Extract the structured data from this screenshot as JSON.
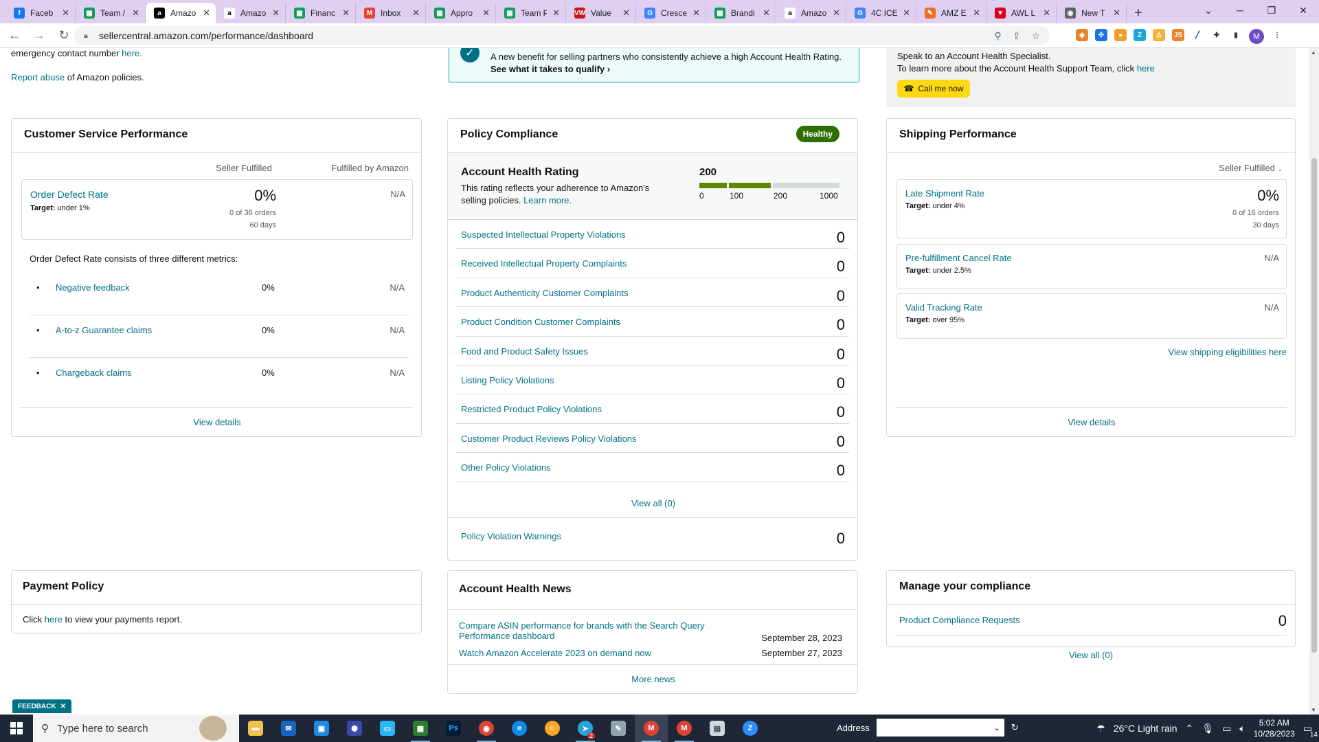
{
  "browser": {
    "tabs": [
      {
        "title": "Faceb",
        "icon": "facebook-icon",
        "color": "#1877f2",
        "glyph": "f"
      },
      {
        "title": "Team /",
        "icon": "sheets-icon",
        "color": "#0f9d58",
        "glyph": "▦"
      },
      {
        "title": "Amazo",
        "icon": "amazon-icon",
        "color": "#000000",
        "glyph": "a",
        "active": true
      },
      {
        "title": "Amazo",
        "icon": "amazon-icon",
        "color": "#ffffff",
        "glyph": "a"
      },
      {
        "title": "Financ",
        "icon": "sheets-icon",
        "color": "#0f9d58",
        "glyph": "▦"
      },
      {
        "title": "Inbox",
        "icon": "gmail-icon",
        "color": "#ea4335",
        "glyph": "M"
      },
      {
        "title": "Appro",
        "icon": "sheets-icon",
        "color": "#0f9d58",
        "glyph": "▦"
      },
      {
        "title": "Team P",
        "icon": "sheets-icon",
        "color": "#0f9d58",
        "glyph": "▦"
      },
      {
        "title": "Value",
        "icon": "vw-icon",
        "color": "#c4161c",
        "glyph": "VW"
      },
      {
        "title": "Cresce",
        "icon": "google-icon",
        "color": "#4285f4",
        "glyph": "G"
      },
      {
        "title": "Brandi",
        "icon": "sheets-icon",
        "color": "#0f9d58",
        "glyph": "▦"
      },
      {
        "title": "Amazo",
        "icon": "amazon-icon",
        "color": "#ffffff",
        "glyph": "a"
      },
      {
        "title": "4C ICE",
        "icon": "google-icon",
        "color": "#4285f4",
        "glyph": "G"
      },
      {
        "title": "AMZ E",
        "icon": "pen-icon",
        "color": "#f26b1d",
        "glyph": "✎"
      },
      {
        "title": "AWL L",
        "icon": "awl-icon",
        "color": "#d6001c",
        "glyph": "▼"
      },
      {
        "title": "New T",
        "icon": "chrome-icon",
        "color": "#5f6368",
        "glyph": "◉"
      }
    ],
    "new_tab": "+",
    "url": "sellercentral.amazon.com/performance/dashboard",
    "profile_initial": "M"
  },
  "top": {
    "emergency_text": "emergency contact number",
    "emergency_link": "here.",
    "report_link": "Report abuse",
    "report_rest": "of Amazon policies.",
    "banner_text": "A new benefit for selling partners who consistently achieve a high Account Health Rating.",
    "banner_link": "See what it takes to qualify",
    "aht_line1": "Speak to an Account Health Specialist.",
    "aht_line2": "To learn more about the Account Health Support Team, click",
    "aht_link": "here",
    "call_label": "Call me now"
  },
  "csp": {
    "title": "Customer Service Performance",
    "col1": "Seller Fulfilled",
    "col2": "Fulfilled by Amazon",
    "odr_label": "Order Defect Rate",
    "odr_target": "under 1%",
    "target_word": "Target:",
    "odr_value": "0%",
    "odr_orders": "0 of 36 orders",
    "odr_days": "60 days",
    "odr_fba": "N/A",
    "consists": "Order Defect Rate consists of three different metrics:",
    "metrics": [
      {
        "label": "Negative feedback",
        "sf": "0%",
        "fba": "N/A"
      },
      {
        "label": "A-to-z Guarantee claims",
        "sf": "0%",
        "fba": "N/A"
      },
      {
        "label": "Chargeback claims",
        "sf": "0%",
        "fba": "N/A"
      }
    ],
    "view_details": "View details"
  },
  "policy": {
    "title": "Policy Compliance",
    "badge": "Healthy",
    "ahr_title": "Account Health Rating",
    "ahr_desc1": "This rating reflects your adherence to Amazon's",
    "ahr_desc2": "selling policies.",
    "ahr_learn": "Learn more.",
    "ahr_value": "200",
    "scale": [
      "0",
      "100",
      "200",
      "1000"
    ],
    "items": [
      {
        "label": "Suspected Intellectual Property Violations",
        "count": "0"
      },
      {
        "label": "Received Intellectual Property Complaints",
        "count": "0"
      },
      {
        "label": "Product Authenticity Customer Complaints",
        "count": "0"
      },
      {
        "label": "Product Condition Customer Complaints",
        "count": "0"
      },
      {
        "label": "Food and Product Safety Issues",
        "count": "0"
      },
      {
        "label": "Listing Policy Violations",
        "count": "0"
      },
      {
        "label": "Restricted Product Policy Violations",
        "count": "0"
      },
      {
        "label": "Customer Product Reviews Policy Violations",
        "count": "0"
      },
      {
        "label": "Other Policy Violations",
        "count": "0"
      }
    ],
    "view_all": "View all (0)",
    "warnings_label": "Policy Violation Warnings",
    "warnings_count": "0"
  },
  "shipping": {
    "title": "Shipping Performance",
    "filter": "Seller Fulfilled",
    "target_word": "Target:",
    "late_label": "Late Shipment Rate",
    "late_target": "under 4%",
    "late_value": "0%",
    "late_orders": "0 of 16 orders",
    "late_days": "30 days",
    "cancel_label": "Pre-fulfillment Cancel Rate",
    "cancel_target": "under 2.5%",
    "cancel_value": "N/A",
    "vtr_label": "Valid Tracking Rate",
    "vtr_target": "over 95%",
    "vtr_value": "N/A",
    "eligibilities": "View shipping eligibilities here",
    "view_details": "View details"
  },
  "payment": {
    "title": "Payment Policy",
    "click": "Click",
    "here": "here",
    "rest": "to view your payments report."
  },
  "news": {
    "title": "Account Health News",
    "items": [
      {
        "line1": "Compare ASIN performance for brands with the Search Query",
        "line2": "Performance dashboard",
        "date": "September 28, 2023"
      },
      {
        "line1": "Watch Amazon Accelerate 2023 on demand now",
        "line2": "",
        "date": "September 27, 2023"
      }
    ],
    "more": "More news"
  },
  "compliance": {
    "title": "Manage your compliance",
    "requests_label": "Product Compliance Requests",
    "requests_count": "0",
    "view_all": "View all (0)"
  },
  "feedback": "FEEDBACK",
  "taskbar": {
    "search_placeholder": "Type here to search",
    "address_label": "Address",
    "weather": "26°C  Light rain",
    "time": "5:02 AM",
    "date": "10/28/2023",
    "notif_count": "14",
    "chat_badge": "2"
  },
  "colors": {
    "link": "#007185",
    "healthy": "#2f6f00",
    "bar_green": "#5b8a00",
    "bar_grey": "#d5d9d9",
    "call_yellow": "#ffd814"
  }
}
